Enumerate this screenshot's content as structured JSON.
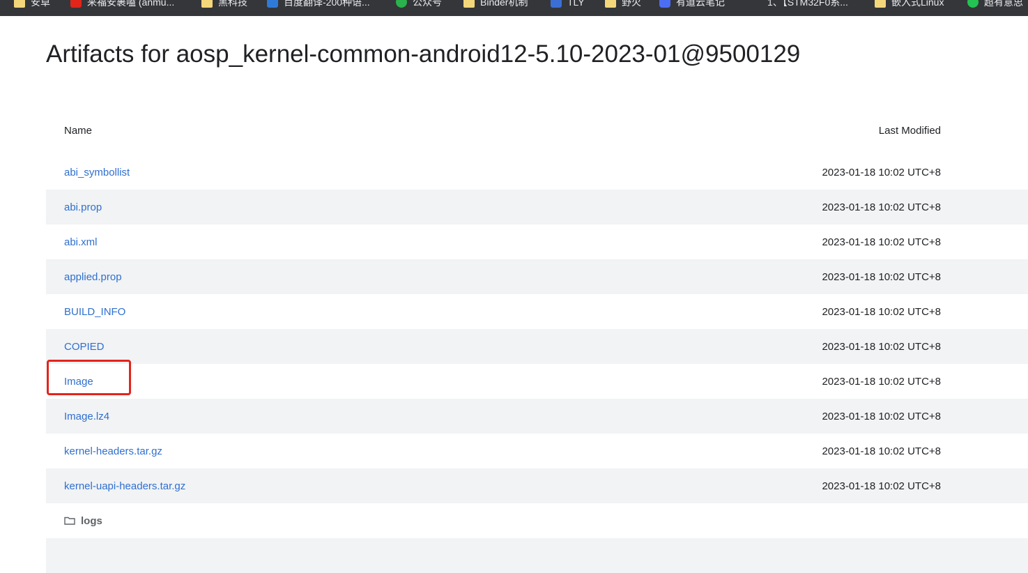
{
  "bookmarks": [
    {
      "label": "安卓",
      "icon": "folder-icon"
    },
    {
      "label": "来福安裹嗑 (anmu...",
      "icon": "red-app-icon"
    },
    {
      "label": "黑科技",
      "icon": "folder-icon"
    },
    {
      "label": "百度翻译-200种语...",
      "icon": "translate-icon"
    },
    {
      "label": "公众号",
      "icon": "green-circle-icon"
    },
    {
      "label": "Binder机制",
      "icon": "folder-icon"
    },
    {
      "label": "TLY",
      "icon": "tly-icon"
    },
    {
      "label": "野火",
      "icon": "folder-icon"
    },
    {
      "label": "有道云笔记",
      "icon": "youdao-note-icon"
    },
    {
      "label": "1、【STM32F0系...",
      "icon": ""
    },
    {
      "label": "嵌入式Linux",
      "icon": "folder-icon"
    },
    {
      "label": "超有意思",
      "icon": "wechat-icon"
    }
  ],
  "page": {
    "title": "Artifacts for aosp_kernel-common-android12-5.10-2023-01@9500129"
  },
  "table": {
    "headers": {
      "name": "Name",
      "modified": "Last Modified"
    },
    "rows": [
      {
        "name": "abi_symbollist",
        "modified": "2023-01-18 10:02 UTC+8"
      },
      {
        "name": "abi.prop",
        "modified": "2023-01-18 10:02 UTC+8"
      },
      {
        "name": "abi.xml",
        "modified": "2023-01-18 10:02 UTC+8"
      },
      {
        "name": "applied.prop",
        "modified": "2023-01-18 10:02 UTC+8"
      },
      {
        "name": "BUILD_INFO",
        "modified": "2023-01-18 10:02 UTC+8"
      },
      {
        "name": "COPIED",
        "modified": "2023-01-18 10:02 UTC+8"
      },
      {
        "name": "Image",
        "modified": "2023-01-18 10:02 UTC+8"
      },
      {
        "name": "Image.lz4",
        "modified": "2023-01-18 10:02 UTC+8"
      },
      {
        "name": "kernel-headers.tar.gz",
        "modified": "2023-01-18 10:02 UTC+8"
      },
      {
        "name": "kernel-uapi-headers.tar.gz",
        "modified": "2023-01-18 10:02 UTC+8"
      }
    ],
    "folders": [
      {
        "name": "logs"
      }
    ]
  },
  "annotation": {
    "color": "#e3241b",
    "target": "Image"
  }
}
